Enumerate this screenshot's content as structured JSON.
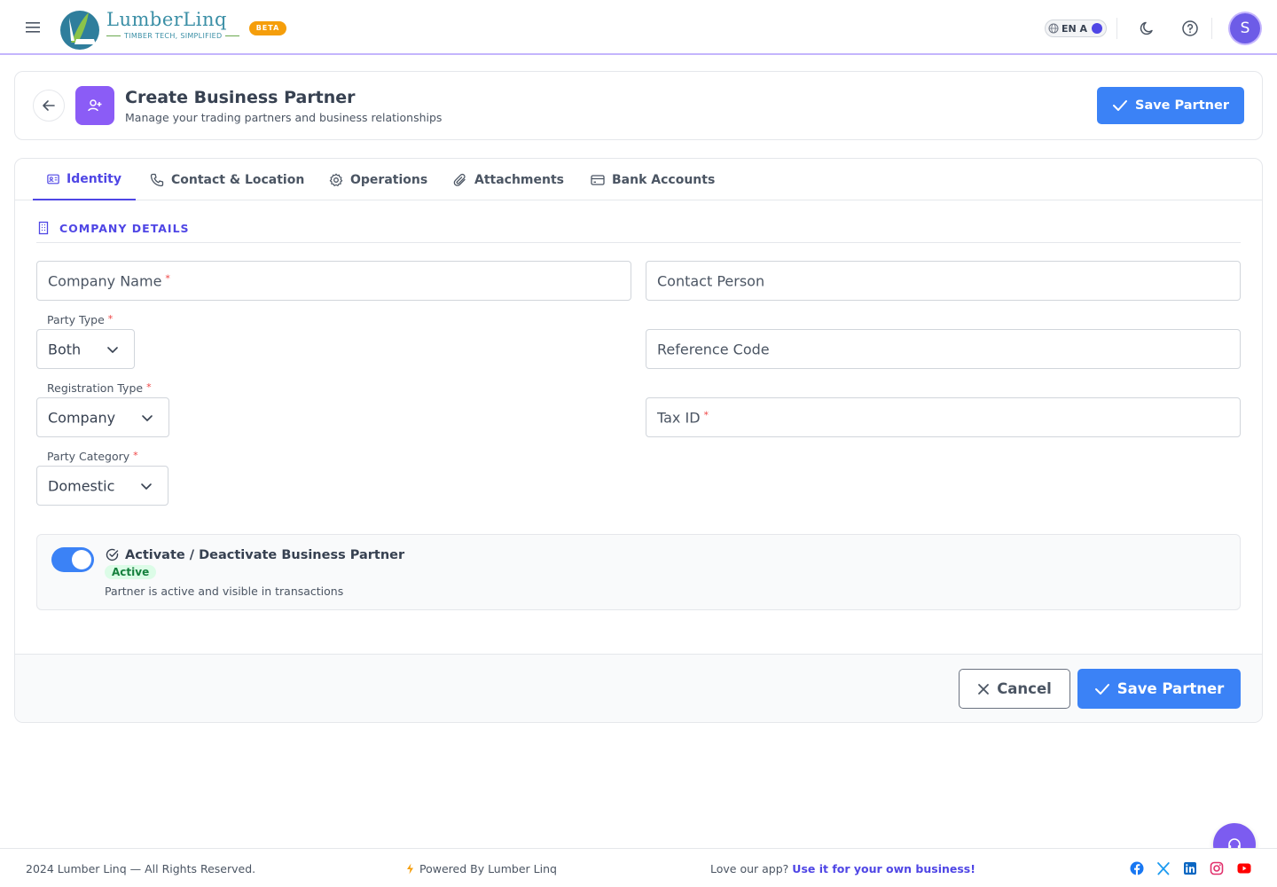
{
  "brand": {
    "name": "LumberLinq",
    "tagline": "TIMBER TECH, SIMPLIFIED",
    "badge": "BETA"
  },
  "topbar": {
    "language": "EN A",
    "avatar_initial": "S",
    "icons": [
      "menu-icon",
      "globe-icon",
      "moon-icon",
      "help-icon"
    ]
  },
  "header": {
    "title": "Create Business Partner",
    "subtitle": "Manage your trading partners and business relationships",
    "save_label": "Save Partner"
  },
  "tabs": [
    {
      "label": "Identity",
      "icon": "id-card-icon",
      "active": true
    },
    {
      "label": "Contact & Location",
      "icon": "phone-icon",
      "active": false
    },
    {
      "label": "Operations",
      "icon": "gear-icon",
      "active": false
    },
    {
      "label": "Attachments",
      "icon": "paperclip-icon",
      "active": false
    },
    {
      "label": "Bank Accounts",
      "icon": "card-icon",
      "active": false
    }
  ],
  "section": {
    "title": "COMPANY DETAILS",
    "icon": "building-icon"
  },
  "form": {
    "company_name": {
      "placeholder": "Company Name",
      "required_mark": "*"
    },
    "contact_person": {
      "placeholder": "Contact Person"
    },
    "party_type": {
      "label": "Party Type",
      "required_mark": "*",
      "value": "Both"
    },
    "reference_code": {
      "placeholder": "Reference Code"
    },
    "registration_type": {
      "label": "Registration Type",
      "required_mark": "*",
      "value": "Company"
    },
    "tax_id": {
      "placeholder": "Tax ID",
      "required_mark": "*"
    },
    "party_category": {
      "label": "Party Category",
      "required_mark": "*",
      "value": "Domestic"
    }
  },
  "status": {
    "title": "Activate / Deactivate Business Partner",
    "badge": "Active",
    "description": "Partner is active and visible in transactions",
    "enabled": true
  },
  "actions": {
    "cancel_label": "Cancel",
    "save_label": "Save Partner"
  },
  "footer": {
    "copyright": "2024 Lumber Linq — All Rights Reserved.",
    "powered_by": "Powered By Lumber Linq",
    "promo_text": "Love our app?",
    "promo_link": "Use it for your own business!",
    "social": [
      "facebook-icon",
      "x-icon",
      "linkedin-icon",
      "instagram-icon",
      "youtube-icon"
    ]
  },
  "colors": {
    "primary": "#3b82f6",
    "accent": "#4f46e5",
    "purple": "#8b5cf6",
    "required": "#ef4444",
    "success_bg": "#dcfce7",
    "success_text": "#15803d",
    "beta": "#f59e0b"
  }
}
